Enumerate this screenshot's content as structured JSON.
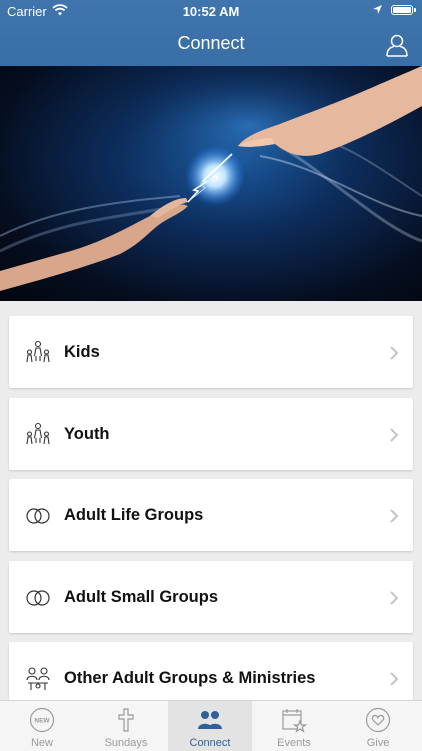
{
  "status_bar": {
    "carrier": "Carrier",
    "time": "10:52 AM"
  },
  "header": {
    "title": "Connect"
  },
  "hero": {
    "image": "two hands reaching toward each other with electric spark"
  },
  "list": [
    {
      "label": "Kids",
      "icon": "family-icon"
    },
    {
      "label": "Youth",
      "icon": "family-icon"
    },
    {
      "label": "Adult Life Groups",
      "icon": "circles-icon"
    },
    {
      "label": "Adult Small Groups",
      "icon": "circles-icon"
    },
    {
      "label": "Other Adult Groups & Ministries",
      "icon": "people-icon"
    }
  ],
  "tabs": [
    {
      "label": "New",
      "icon": "new-badge-icon",
      "active": false
    },
    {
      "label": "Sundays",
      "icon": "cross-icon",
      "active": false
    },
    {
      "label": "Connect",
      "icon": "group-icon",
      "active": true
    },
    {
      "label": "Events",
      "icon": "calendar-star-icon",
      "active": false
    },
    {
      "label": "Give",
      "icon": "heart-icon",
      "active": false
    }
  ],
  "colors": {
    "header": "#3a6ea6",
    "active_tab": "#2e5f99",
    "inactive_tab": "#9a9a9a"
  }
}
